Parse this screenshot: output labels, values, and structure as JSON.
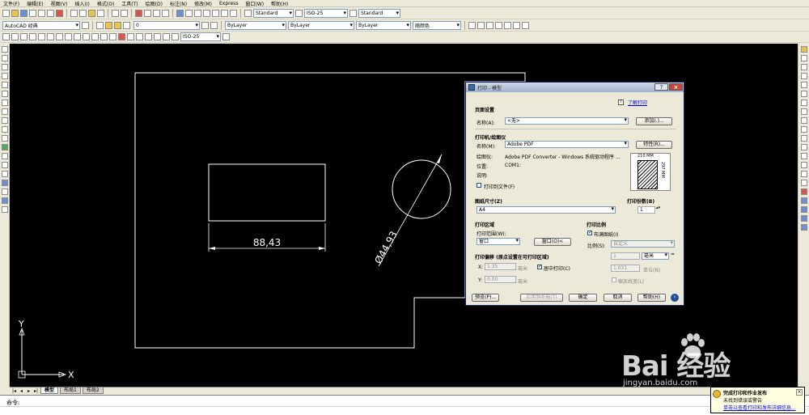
{
  "menu": [
    "文件(F)",
    "编辑(E)",
    "视图(V)",
    "插入(I)",
    "格式(O)",
    "工具(T)",
    "绘图(D)",
    "标注(N)",
    "修改(M)",
    "Express",
    "窗口(W)",
    "帮助(H)"
  ],
  "toolbar": {
    "text_style": "Standard",
    "dim_style": "ISO-25",
    "table_style": "Standard",
    "workspace": "AutoCAD 经典",
    "dim_style2": "ISO-25",
    "layer": "ByLayer",
    "linetype": "ByLayer",
    "lineweight": "ByLayer",
    "plotstyle": "随颜色"
  },
  "drawing": {
    "dim_linear": "88,43",
    "dim_diameter": "Ø44,93",
    "axis_x": "X",
    "axis_y": "Y"
  },
  "layout_tabs": [
    "模型",
    "布局1",
    "布局2"
  ],
  "command": {
    "prompt": "命令:"
  },
  "balloon": {
    "title": "完成打印和作业发布",
    "line2": "未找到错误或警告",
    "link": "单击以查看打印和发布详细信息..."
  },
  "dialog": {
    "title": "打印 - 模型",
    "help_link": "了解打印",
    "page_setup": {
      "group": "页面设置",
      "name_label": "名称(A):",
      "name_value": "<无>",
      "add_button": "添加(.)..."
    },
    "printer": {
      "group": "打印机/绘图仪",
      "name_label": "名称(M):",
      "name_value": "Adobe PDF",
      "properties_button": "特性(R)...",
      "plotter_label": "绘图仪:",
      "plotter_value": "Adobe PDF Converter - Windows 系统驱动程序 ...",
      "where_label": "位置:",
      "where_value": "COM1:",
      "desc_label": "说明:",
      "plot_to_file": "打印到文件(F)",
      "preview_w": "210 MM",
      "preview_h": "297 MM"
    },
    "paper": {
      "group": "图纸尺寸(Z)",
      "value": "A4"
    },
    "copies": {
      "label": "打印份数(B)",
      "value": "1"
    },
    "area": {
      "group": "打印区域",
      "what_label": "打印范围(W):",
      "what_value": "窗口",
      "window_button": "窗口(O)<"
    },
    "offset": {
      "group": "打印偏移 (原点设置在可打印区域)",
      "x_label": "X:",
      "x_value": "1.35",
      "y_label": "Y:",
      "y_value": "0.00",
      "unit": "毫米",
      "center": "居中打印(C)"
    },
    "scale": {
      "group": "打印比例",
      "fit": "布满图纸(I)",
      "scale_label": "比例(S):",
      "scale_value": "自定义",
      "v1": "1",
      "unit": "毫米",
      "v2": "1.031",
      "unit2": "单位(N)",
      "lineweights": "缩放线宽(L)"
    },
    "buttons": {
      "preview": "预览(P)...",
      "apply": "应用到布局(T)",
      "ok": "确定",
      "cancel": "取消",
      "help": "帮助(H)"
    }
  },
  "watermark": {
    "brand": "Bai   经验",
    "url": "jingyan.baidu.com"
  }
}
